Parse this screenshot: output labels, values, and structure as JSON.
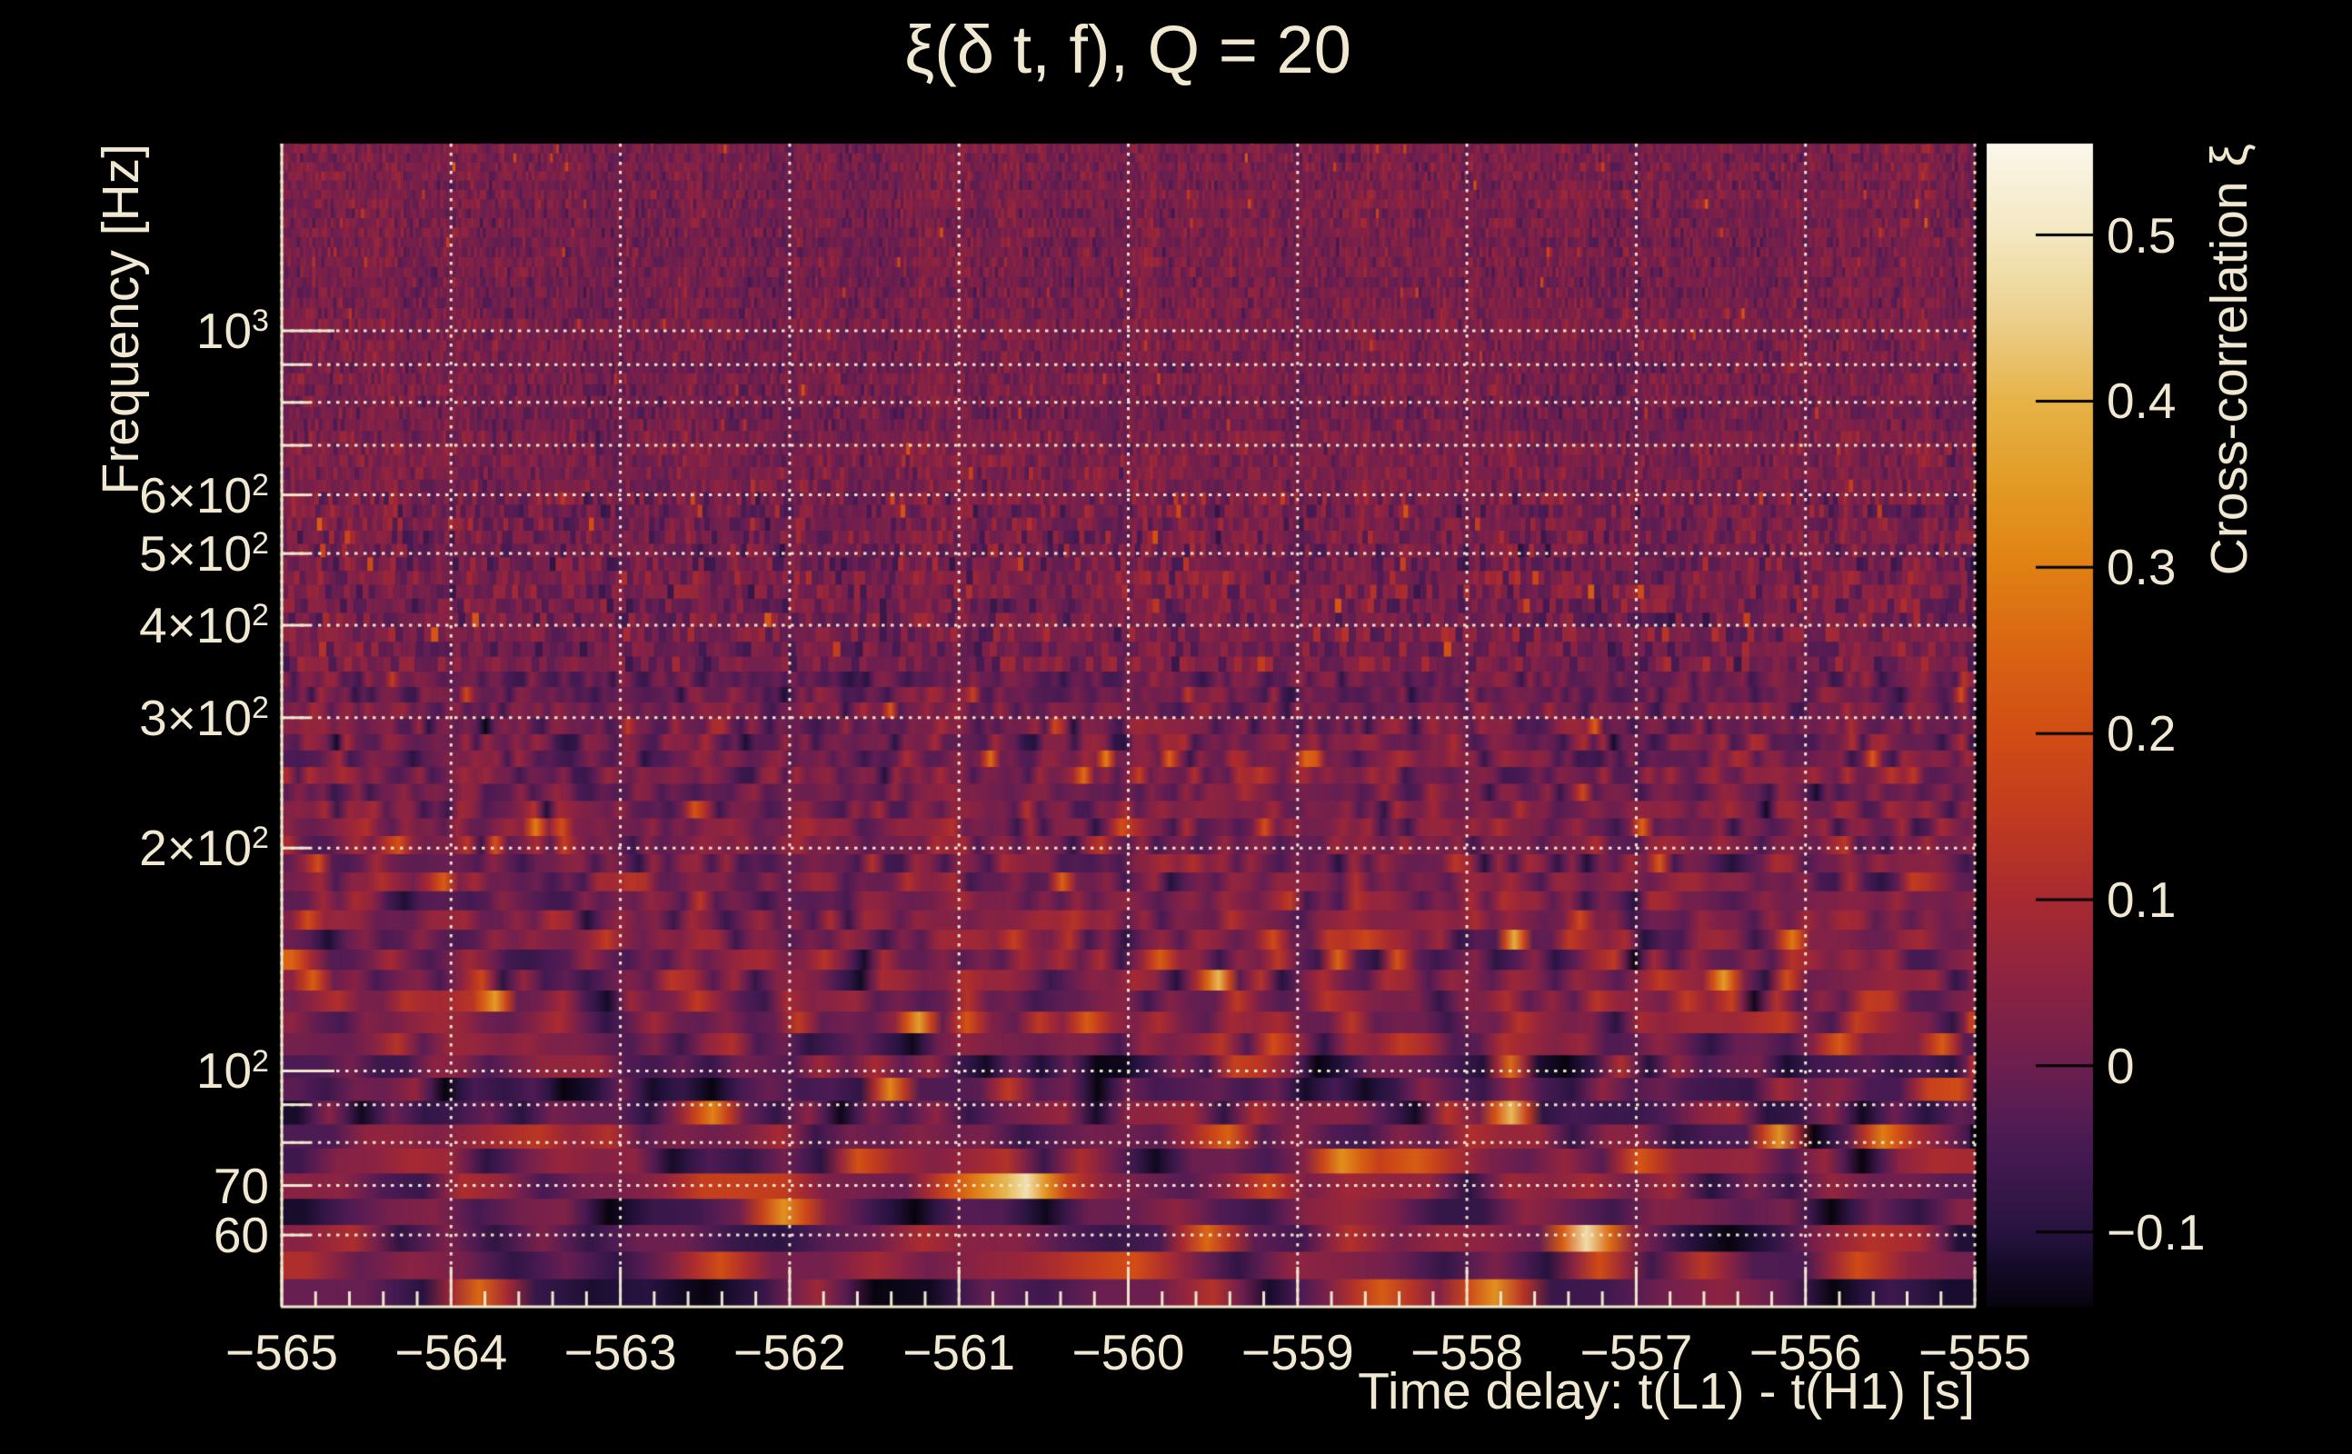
{
  "title": "ξ(δ t, f), Q = 20",
  "axes": {
    "x": {
      "label": "Time delay: t(L1) - t(H1) [s]",
      "min": -565,
      "max": -555,
      "ticks": [
        {
          "t": -565,
          "label": "−565"
        },
        {
          "t": -564,
          "label": "−564"
        },
        {
          "t": -563,
          "label": "−563"
        },
        {
          "t": -562,
          "label": "−562"
        },
        {
          "t": -561,
          "label": "−561"
        },
        {
          "t": -560,
          "label": "−560"
        },
        {
          "t": -559,
          "label": "−559"
        },
        {
          "t": -558,
          "label": "−558"
        },
        {
          "t": -557,
          "label": "−557"
        },
        {
          "t": -556,
          "label": "−556"
        },
        {
          "t": -555,
          "label": "−555"
        }
      ],
      "minor_tick_step": 0.2
    },
    "y": {
      "label": "Frequency [Hz]",
      "scale": "log",
      "min": 48,
      "max": 1790,
      "ticks": [
        {
          "f": 1000,
          "text": "10",
          "sup": "3"
        },
        {
          "f": 600,
          "text": "6×10",
          "sup": "2"
        },
        {
          "f": 500,
          "text": "5×10",
          "sup": "2"
        },
        {
          "f": 400,
          "text": "4×10",
          "sup": "2"
        },
        {
          "f": 300,
          "text": "3×10",
          "sup": "2"
        },
        {
          "f": 200,
          "text": "2×10",
          "sup": "2"
        },
        {
          "f": 100,
          "text": "10",
          "sup": "2"
        },
        {
          "f": 70,
          "text": "70",
          "sup": ""
        },
        {
          "f": 60,
          "text": "60",
          "sup": ""
        }
      ],
      "gridlines": [
        60,
        70,
        80,
        90,
        100,
        200,
        300,
        400,
        500,
        600,
        700,
        800,
        900,
        1000
      ]
    }
  },
  "colorbar": {
    "label": "Cross-correlation ξ",
    "min": -0.145,
    "max": 0.555,
    "ticks": [
      {
        "v": 0.5,
        "label": "0.5"
      },
      {
        "v": 0.4,
        "label": "0.4"
      },
      {
        "v": 0.3,
        "label": "0.3"
      },
      {
        "v": 0.2,
        "label": "0.2"
      },
      {
        "v": 0.1,
        "label": "0.1"
      },
      {
        "v": 0.0,
        "label": "0"
      },
      {
        "v": -0.1,
        "label": "−0.1"
      }
    ]
  },
  "colors": {
    "background": "#000000",
    "text": "#f0e8d0",
    "grid": "#efe7cd",
    "frame": "#efe7cd",
    "colorbar_tick": "#000000",
    "palette": [
      [
        -0.145,
        "#07040e"
      ],
      [
        -0.12,
        "#150b29"
      ],
      [
        -0.1,
        "#271340"
      ],
      [
        -0.075,
        "#371749"
      ],
      [
        -0.05,
        "#471a53"
      ],
      [
        -0.025,
        "#5a1d52"
      ],
      [
        0.0,
        "#6d1f4f"
      ],
      [
        0.025,
        "#7d2148"
      ],
      [
        0.05,
        "#8c2342"
      ],
      [
        0.075,
        "#9a2739"
      ],
      [
        0.1,
        "#a82a31"
      ],
      [
        0.15,
        "#c13b1f"
      ],
      [
        0.2,
        "#d24d15"
      ],
      [
        0.25,
        "#da6413"
      ],
      [
        0.3,
        "#e08113"
      ],
      [
        0.35,
        "#e39b26"
      ],
      [
        0.4,
        "#e7b348"
      ],
      [
        0.45,
        "#ecd08d"
      ],
      [
        0.5,
        "#f4e8c0"
      ],
      [
        0.555,
        "#fbf7ec"
      ]
    ]
  },
  "chart_data": {
    "type": "heatmap",
    "title": "ξ(δ t, f), Q = 20",
    "xlabel": "Time delay: t(L1) - t(H1) [s]",
    "ylabel": "Frequency [Hz]",
    "zlabel": "Cross-correlation ξ",
    "q_value": 20,
    "x_range": [
      -565,
      -555
    ],
    "x_major_tick_step": 1,
    "x_minor_tick_step": 0.2,
    "y_range": [
      48,
      1790
    ],
    "y_scale": "log",
    "y_gridlines": [
      60,
      70,
      80,
      90,
      100,
      200,
      300,
      400,
      500,
      600,
      700,
      800,
      900,
      1000
    ],
    "z_range": [
      -0.145,
      0.555
    ],
    "colorbar_ticks": [
      0.5,
      0.4,
      0.3,
      0.2,
      0.1,
      0,
      -0.1
    ],
    "legend_position": "right-colorbar",
    "grid": "dotted, on x major ticks and labeled y decades/subdecades",
    "content_summary": "Q-transform style time–frequency cross-correlation noise map between L1 and H1. Values hover near ξ≈0 (purple) across the band; variance grows toward low frequency with frequent bright speckles ξ≈0.2–0.4 below ~200 Hz, rare near-white peaks ξ≈0.5 below ~70 Hz (e.g. near t≈−555.8 s, f≈53 Hz), and darker bands near 60 Hz and 85–100 Hz. Tile duration shrinks with frequency (fine vertical striations at top, wide smooth blobs at bottom). No coherent signal track is visible.",
    "noise_seed": 1337
  }
}
